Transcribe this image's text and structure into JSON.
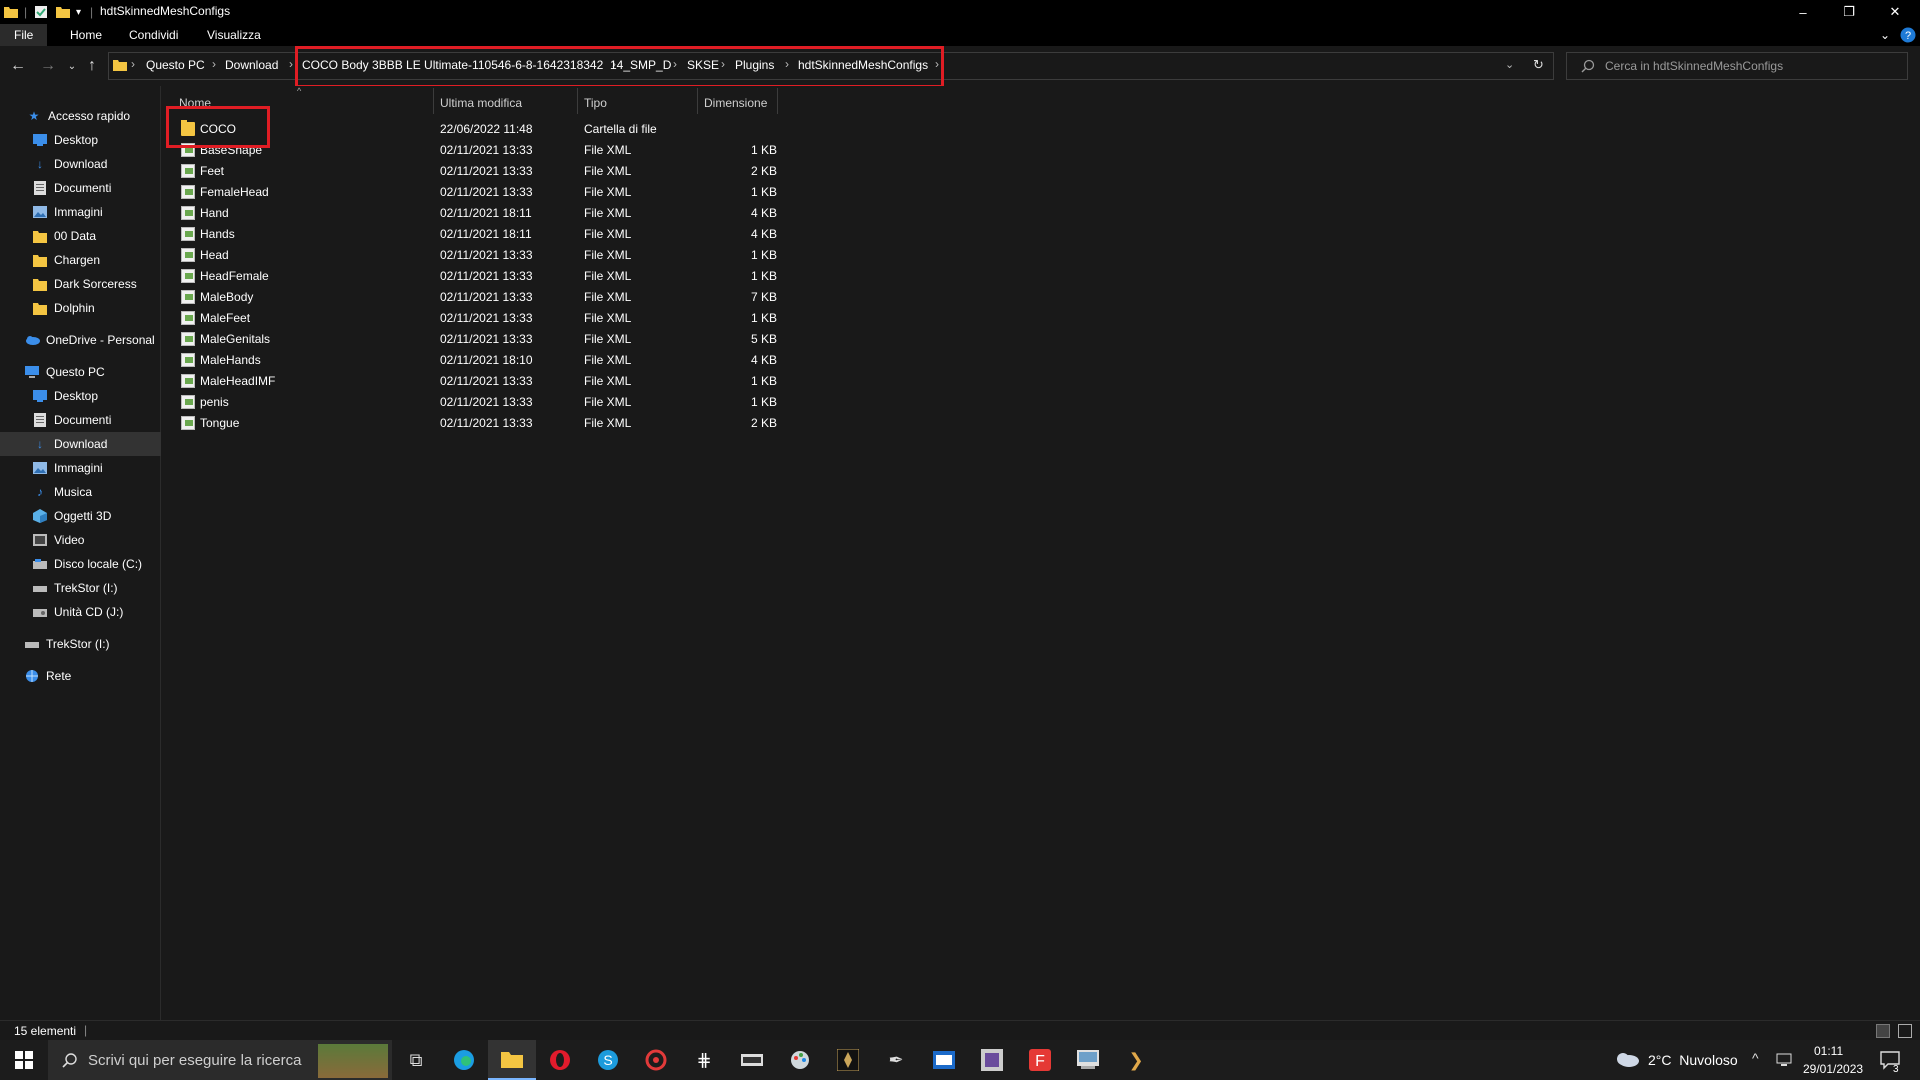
{
  "window": {
    "title": "hdtSkinnedMeshConfigs",
    "controls": {
      "minimize": "–",
      "restore": "❐",
      "close": "✕"
    }
  },
  "ribbon": {
    "tabs": [
      "File",
      "Home",
      "Condividi",
      "Visualizza"
    ]
  },
  "address": {
    "crumbs": [
      "Questo PC",
      "Download",
      "COCO Body 3BBB LE Ultimate-110546-6-8-1642318342",
      "14_SMP_D",
      "SKSE",
      "Plugins",
      "hdtSkinnedMeshConfigs"
    ]
  },
  "search": {
    "placeholder": "Cerca in hdtSkinnedMeshConfigs"
  },
  "sidebar": {
    "items": [
      {
        "label": "Accesso rapido",
        "icon": "star-icon"
      },
      {
        "label": "Desktop",
        "icon": "desktop-icon",
        "pinned": true
      },
      {
        "label": "Download",
        "icon": "download-icon",
        "pinned": true
      },
      {
        "label": "Documenti",
        "icon": "documents-icon",
        "pinned": true
      },
      {
        "label": "Immagini",
        "icon": "pictures-icon",
        "pinned": true
      },
      {
        "label": "00 Data",
        "icon": "folder-icon"
      },
      {
        "label": "Chargen",
        "icon": "folder-icon"
      },
      {
        "label": "Dark Sorceress",
        "icon": "folder-icon"
      },
      {
        "label": "Dolphin",
        "icon": "folder-icon"
      },
      {
        "label": "OneDrive - Personal",
        "icon": "cloud-icon"
      },
      {
        "label": "Questo PC",
        "icon": "computer-icon"
      },
      {
        "label": "Desktop",
        "icon": "desktop-icon"
      },
      {
        "label": "Documenti",
        "icon": "documents-icon"
      },
      {
        "label": "Download",
        "icon": "download-icon",
        "selected": true
      },
      {
        "label": "Immagini",
        "icon": "pictures-icon"
      },
      {
        "label": "Musica",
        "icon": "music-icon"
      },
      {
        "label": "Oggetti 3D",
        "icon": "3d-objects-icon"
      },
      {
        "label": "Video",
        "icon": "video-icon"
      },
      {
        "label": "Disco locale (C:)",
        "icon": "disk-icon"
      },
      {
        "label": "TrekStor (I:)",
        "icon": "drive-icon"
      },
      {
        "label": "Unità CD (J:)",
        "icon": "cd-drive-icon"
      },
      {
        "label": "TrekStor (I:)",
        "icon": "drive-icon"
      },
      {
        "label": "Rete",
        "icon": "network-icon"
      }
    ]
  },
  "columns": {
    "name": "Nome",
    "modified": "Ultima modifica",
    "type": "Tipo",
    "size": "Dimensione"
  },
  "files": [
    {
      "name": "COCO",
      "modified": "22/06/2022 11:48",
      "type": "Cartella di file",
      "size": "",
      "folder": true
    },
    {
      "name": "BaseShape",
      "modified": "02/11/2021 13:33",
      "type": "File XML",
      "size": "1 KB"
    },
    {
      "name": "Feet",
      "modified": "02/11/2021 13:33",
      "type": "File XML",
      "size": "2 KB"
    },
    {
      "name": "FemaleHead",
      "modified": "02/11/2021 13:33",
      "type": "File XML",
      "size": "1 KB"
    },
    {
      "name": "Hand",
      "modified": "02/11/2021 18:11",
      "type": "File XML",
      "size": "4 KB"
    },
    {
      "name": "Hands",
      "modified": "02/11/2021 18:11",
      "type": "File XML",
      "size": "4 KB"
    },
    {
      "name": "Head",
      "modified": "02/11/2021 13:33",
      "type": "File XML",
      "size": "1 KB"
    },
    {
      "name": "HeadFemale",
      "modified": "02/11/2021 13:33",
      "type": "File XML",
      "size": "1 KB"
    },
    {
      "name": "MaleBody",
      "modified": "02/11/2021 13:33",
      "type": "File XML",
      "size": "7 KB"
    },
    {
      "name": "MaleFeet",
      "modified": "02/11/2021 13:33",
      "type": "File XML",
      "size": "1 KB"
    },
    {
      "name": "MaleGenitals",
      "modified": "02/11/2021 13:33",
      "type": "File XML",
      "size": "5 KB"
    },
    {
      "name": "MaleHands",
      "modified": "02/11/2021 18:10",
      "type": "File XML",
      "size": "4 KB"
    },
    {
      "name": "MaleHeadIMF",
      "modified": "02/11/2021 13:33",
      "type": "File XML",
      "size": "1 KB"
    },
    {
      "name": "penis",
      "modified": "02/11/2021 13:33",
      "type": "File XML",
      "size": "1 KB"
    },
    {
      "name": "Tongue",
      "modified": "02/11/2021 13:33",
      "type": "File XML",
      "size": "2 KB"
    }
  ],
  "status": {
    "count": "15 elementi"
  },
  "taskbar": {
    "search_placeholder": "Scrivi qui per eseguire la ricerca",
    "weather": "2°C  Nuvoloso",
    "time": "01:11",
    "date": "29/01/2023",
    "notifications": "3"
  },
  "colors": {
    "accent": "#e01d24",
    "folder": "#f4c542",
    "background": "#191919",
    "selection": "#333333"
  }
}
